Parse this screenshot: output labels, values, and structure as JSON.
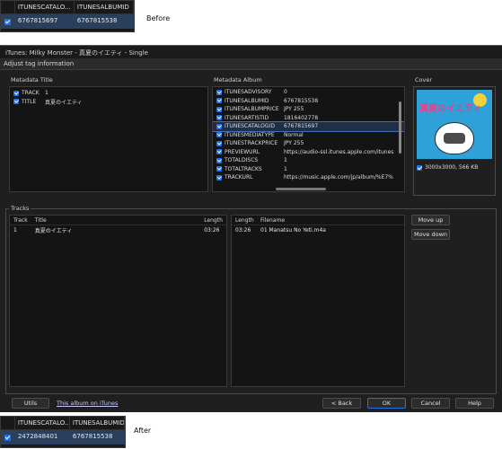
{
  "before_label": "Before",
  "after_label": "After",
  "before_table": {
    "col1": "ITUNESCATALO...",
    "col2": "ITUNESALBUMID",
    "val1": "6767815697",
    "val2": "6767815538"
  },
  "after_table": {
    "col1": "ITUNESCATALO...",
    "col2": "ITUNESALBUMID",
    "val1": "2472848401",
    "val2": "6767815538"
  },
  "window": {
    "title": "iTunes: Milky Monster - 真夏のイエティ - Single",
    "subtitle": "Adjust tag information"
  },
  "metadata_title": {
    "group_label": "Metadata Title",
    "rows": [
      {
        "key": "TRACK",
        "value": "1"
      },
      {
        "key": "TITLE",
        "value": "真夏のイエティ"
      }
    ]
  },
  "metadata_album": {
    "group_label": "Metadata Album",
    "rows": [
      {
        "key": "ITUNESADVISORY",
        "value": "0"
      },
      {
        "key": "ITUNESALBUMID",
        "value": "6767815538"
      },
      {
        "key": "ITUNESALBUMPRICE",
        "value": "JPY 255"
      },
      {
        "key": "ITUNESARTISTID",
        "value": "1816402778"
      },
      {
        "key": "ITUNESCATALOGID",
        "value": "6767815697"
      },
      {
        "key": "ITUNESMEDIATYPE",
        "value": "Normal"
      },
      {
        "key": "ITUNESTRACKPRICE",
        "value": "JPY 255"
      },
      {
        "key": "PREVIEWURL",
        "value": "https://audio-ssl.itunes.apple.com/itunes"
      },
      {
        "key": "TOTALDISCS",
        "value": "1"
      },
      {
        "key": "TOTALTRACKS",
        "value": "1"
      },
      {
        "key": "TRACKURL",
        "value": "https://music.apple.com/jp/album/%E7%"
      }
    ]
  },
  "cover": {
    "group_label": "Cover",
    "art_text": "真夏のイエティ",
    "size_text": "3000x3000, 566 KB"
  },
  "tracks": {
    "group_label": "Tracks",
    "left_headers": [
      "Track",
      "Title",
      "Length"
    ],
    "left_rows": [
      {
        "track": "1",
        "title": "真夏のイエティ",
        "length": "03:26"
      }
    ],
    "right_headers": [
      "Length",
      "Filename"
    ],
    "right_rows": [
      {
        "length": "03:26",
        "filename": "01 Manatsu No Yeti.m4a"
      }
    ],
    "move_up": "Move up",
    "move_down": "Move down"
  },
  "footer": {
    "utils": "Utils",
    "link": "This album on iTunes",
    "back": "< Back",
    "ok": "OK",
    "cancel": "Cancel",
    "help": "Help"
  },
  "colors": {
    "accent": "#1a73e8",
    "selected_row": "#1e2f47"
  }
}
